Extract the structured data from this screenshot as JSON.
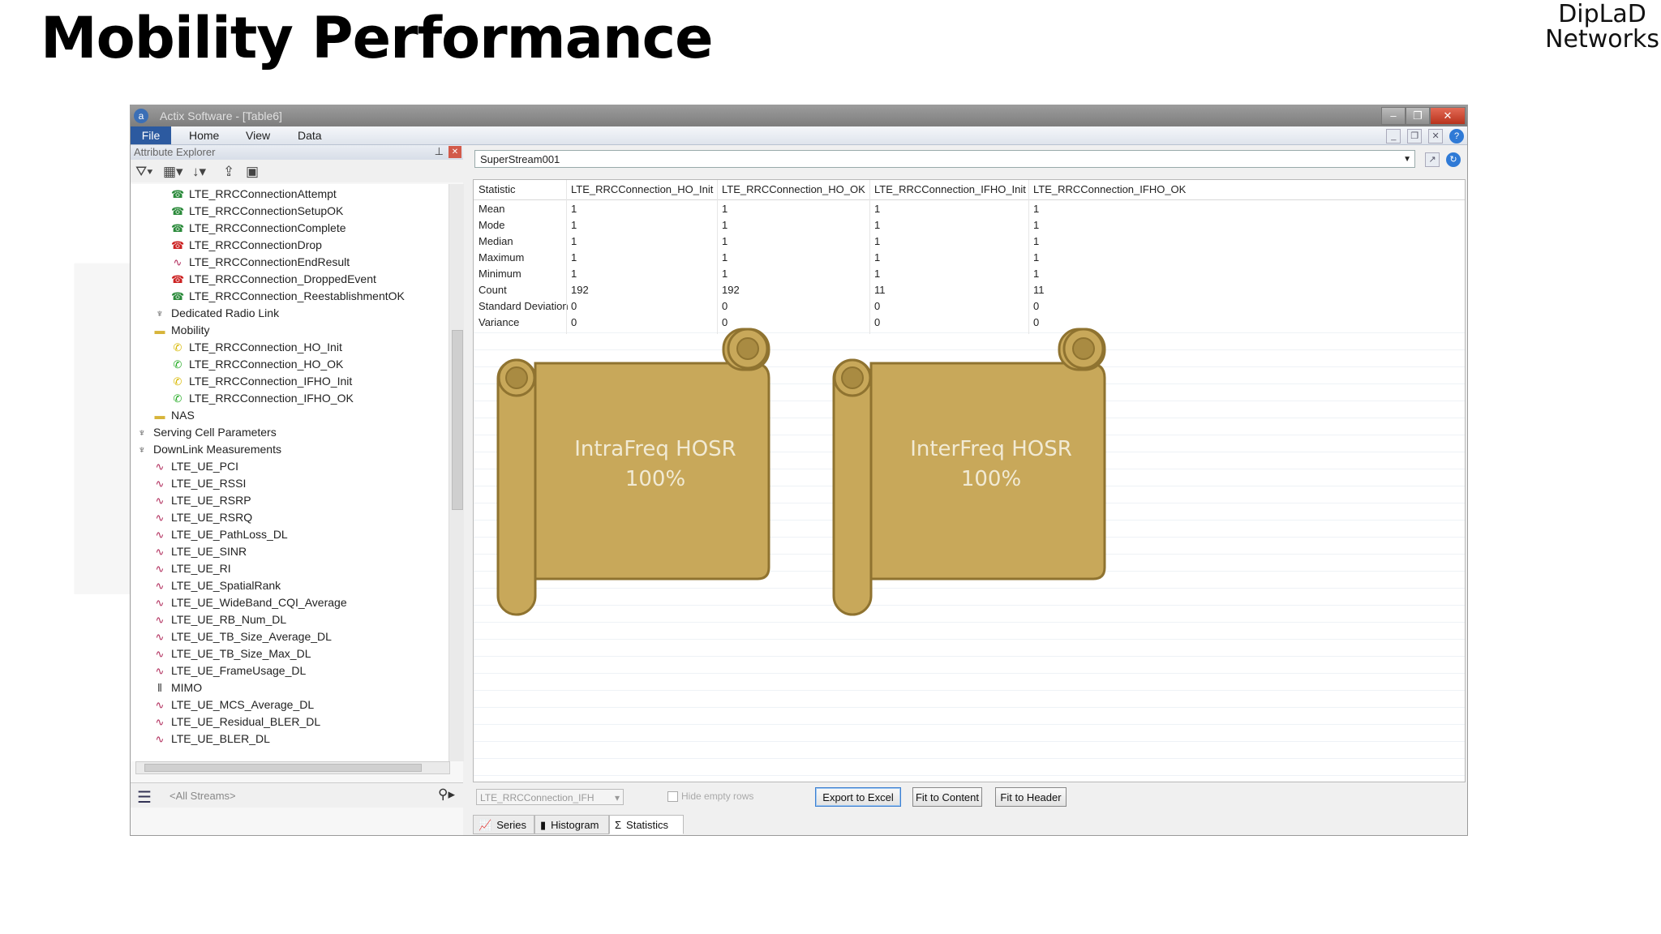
{
  "slide": {
    "title": "Mobility Performance",
    "brand_line1": "DipLaD",
    "brand_line2": "Networks"
  },
  "window": {
    "title": "Actix Software - [Table6]",
    "controls": {
      "minimize": "–",
      "restore": "❐",
      "close": "✕"
    }
  },
  "menu": {
    "items": [
      "File",
      "Home",
      "View",
      "Data"
    ]
  },
  "attribute_explorer": {
    "header": "Attribute Explorer",
    "tree": [
      {
        "label": "LTE_RRCConnectionAttempt",
        "icon": "phone-connect-icon",
        "indent": 2
      },
      {
        "label": "LTE_RRCConnectionSetupOK",
        "icon": "phone-connect-icon",
        "indent": 2
      },
      {
        "label": "LTE_RRCConnectionComplete",
        "icon": "phone-connect-icon",
        "indent": 2
      },
      {
        "label": "LTE_RRCConnectionDrop",
        "icon": "phone-drop-icon",
        "indent": 2
      },
      {
        "label": "LTE_RRCConnectionEndResult",
        "icon": "waveform-icon",
        "indent": 2
      },
      {
        "label": "LTE_RRCConnection_DroppedEvent",
        "icon": "phone-drop-icon",
        "indent": 2
      },
      {
        "label": "LTE_RRCConnection_ReestablishmentOK",
        "icon": "phone-connect-icon",
        "indent": 2
      },
      {
        "label": "Dedicated Radio Link",
        "icon": "tower-icon",
        "indent": 1
      },
      {
        "label": "Mobility",
        "icon": "folder-icon",
        "indent": 1
      },
      {
        "label": "LTE_RRCConnection_HO_Init",
        "icon": "phone-yellow-icon",
        "indent": 2
      },
      {
        "label": "LTE_RRCConnection_HO_OK",
        "icon": "phone-green-icon",
        "indent": 2
      },
      {
        "label": "LTE_RRCConnection_IFHO_Init",
        "icon": "phone-yellow-icon",
        "indent": 2
      },
      {
        "label": "LTE_RRCConnection_IFHO_OK",
        "icon": "phone-green-icon",
        "indent": 2
      },
      {
        "label": "NAS",
        "icon": "folder-icon",
        "indent": 1
      },
      {
        "label": "Serving Cell Parameters",
        "icon": "tower-icon",
        "indent": 0
      },
      {
        "label": "DownLink Measurements",
        "icon": "tower-icon",
        "indent": 0
      },
      {
        "label": "LTE_UE_PCI",
        "icon": "waveform-icon",
        "indent": 1
      },
      {
        "label": "LTE_UE_RSSI",
        "icon": "waveform-icon",
        "indent": 1
      },
      {
        "label": "LTE_UE_RSRP",
        "icon": "waveform-icon",
        "indent": 1
      },
      {
        "label": "LTE_UE_RSRQ",
        "icon": "waveform-icon",
        "indent": 1
      },
      {
        "label": "LTE_UE_PathLoss_DL",
        "icon": "waveform-icon",
        "indent": 1
      },
      {
        "label": "LTE_UE_SINR",
        "icon": "waveform-icon",
        "indent": 1
      },
      {
        "label": "LTE_UE_RI",
        "icon": "waveform-icon",
        "indent": 1
      },
      {
        "label": "LTE_UE_SpatialRank",
        "icon": "waveform-icon",
        "indent": 1
      },
      {
        "label": "LTE_UE_WideBand_CQI_Average",
        "icon": "waveform-icon",
        "indent": 1
      },
      {
        "label": "LTE_UE_RB_Num_DL",
        "icon": "waveform-icon",
        "indent": 1
      },
      {
        "label": "LTE_UE_TB_Size_Average_DL",
        "icon": "waveform-icon",
        "indent": 1
      },
      {
        "label": "LTE_UE_TB_Size_Max_DL",
        "icon": "waveform-icon",
        "indent": 1
      },
      {
        "label": "LTE_UE_FrameUsage_DL",
        "icon": "waveform-icon",
        "indent": 1
      },
      {
        "label": "MIMO",
        "icon": "mimo-icon",
        "indent": 1
      },
      {
        "label": "LTE_UE_MCS_Average_DL",
        "icon": "waveform-icon",
        "indent": 1
      },
      {
        "label": "LTE_UE_Residual_BLER_DL",
        "icon": "waveform-icon",
        "indent": 1
      },
      {
        "label": "LTE_UE_BLER_DL",
        "icon": "waveform-icon",
        "indent": 1
      }
    ],
    "stream_filter": "<All Streams>"
  },
  "statistics": {
    "stream": "SuperStream001",
    "columns": [
      "Statistic",
      "LTE_RRCConnection_HO_Init",
      "LTE_RRCConnection_HO_OK",
      "LTE_RRCConnection_IFHO_Init",
      "LTE_RRCConnection_IFHO_OK"
    ],
    "rows": [
      [
        "Mean",
        "1",
        "1",
        "1",
        "1"
      ],
      [
        "Mode",
        "1",
        "1",
        "1",
        "1"
      ],
      [
        "Median",
        "1",
        "1",
        "1",
        "1"
      ],
      [
        "Maximum",
        "1",
        "1",
        "1",
        "1"
      ],
      [
        "Minimum",
        "1",
        "1",
        "1",
        "1"
      ],
      [
        "Count",
        "192",
        "192",
        "11",
        "11"
      ],
      [
        "Standard Deviation",
        "0",
        "0",
        "0",
        "0"
      ],
      [
        "Variance",
        "0",
        "0",
        "0",
        "0"
      ]
    ],
    "column_combo": "LTE_RRCConnection_IFH",
    "hide_empty_rows": "Hide empty rows",
    "buttons": {
      "export": "Export to Excel",
      "fit_content": "Fit to Content",
      "fit_header": "Fit to Header"
    },
    "tabs": [
      "Series",
      "Histogram",
      "Statistics"
    ]
  },
  "callouts": [
    {
      "line1": "IntraFreq HOSR",
      "line2": "100%"
    },
    {
      "line1": "InterFreq HOSR",
      "line2": "100%"
    }
  ],
  "colors": {
    "scroll_fill": "#c8a85a",
    "scroll_stroke": "#8f7330",
    "accent_blue": "#2c5aa0"
  }
}
